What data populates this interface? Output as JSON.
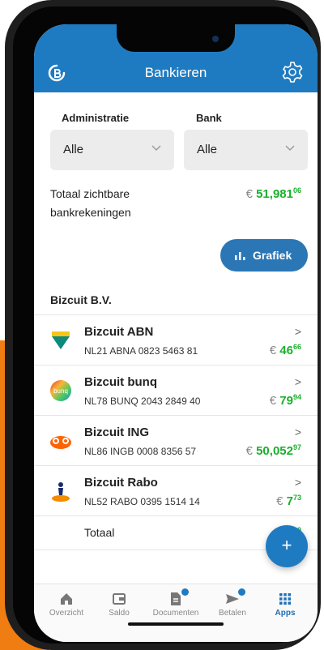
{
  "header": {
    "title": "Bankieren"
  },
  "filters": {
    "administratie_label": "Administratie",
    "administratie_value": "Alle",
    "bank_label": "Bank",
    "bank_value": "Alle"
  },
  "summary": {
    "label": "Totaal zichtbare bankrekeningen",
    "currency": "€",
    "amount_main": "51,981",
    "amount_cents": "06"
  },
  "grafiek_button": {
    "label": "Grafiek"
  },
  "company": "Bizcuit B.V.",
  "accounts": [
    {
      "name": "Bizcuit ABN",
      "iban": "NL21 ABNA 0823 5463 81",
      "currency": "€",
      "amount_main": "46",
      "amount_cents": "66",
      "icon": "abn-amro-icon"
    },
    {
      "name": "Bizcuit bunq",
      "iban": "NL78 BUNQ 2043 2849 40",
      "currency": "€",
      "amount_main": "79",
      "amount_cents": "94",
      "icon": "bunq-icon"
    },
    {
      "name": "Bizcuit ING",
      "iban": "NL86 INGB 0008 8356 57",
      "currency": "€",
      "amount_main": "50,052",
      "amount_cents": "97",
      "icon": "ing-lion-icon"
    },
    {
      "name": "Bizcuit Rabo",
      "iban": "NL52 RABO 0395 1514 14",
      "currency": "€",
      "amount_main": "7",
      "amount_cents": "73",
      "icon": "rabobank-icon"
    }
  ],
  "total_row": {
    "label": "Totaal",
    "currency": "€",
    "amount_main": "50",
    "amount_cents": "0"
  },
  "fab": {
    "label": "+"
  },
  "tabs": [
    {
      "label": "Overzicht",
      "icon": "home-icon"
    },
    {
      "label": "Saldo",
      "icon": "wallet-icon"
    },
    {
      "label": "Documenten",
      "icon": "document-icon"
    },
    {
      "label": "Betalen",
      "icon": "send-icon"
    },
    {
      "label": "Apps",
      "icon": "apps-grid-icon"
    }
  ],
  "colors": {
    "primary": "#1f7bc1",
    "amount_green": "#19b02b",
    "accent_orange": "#f07d12"
  }
}
